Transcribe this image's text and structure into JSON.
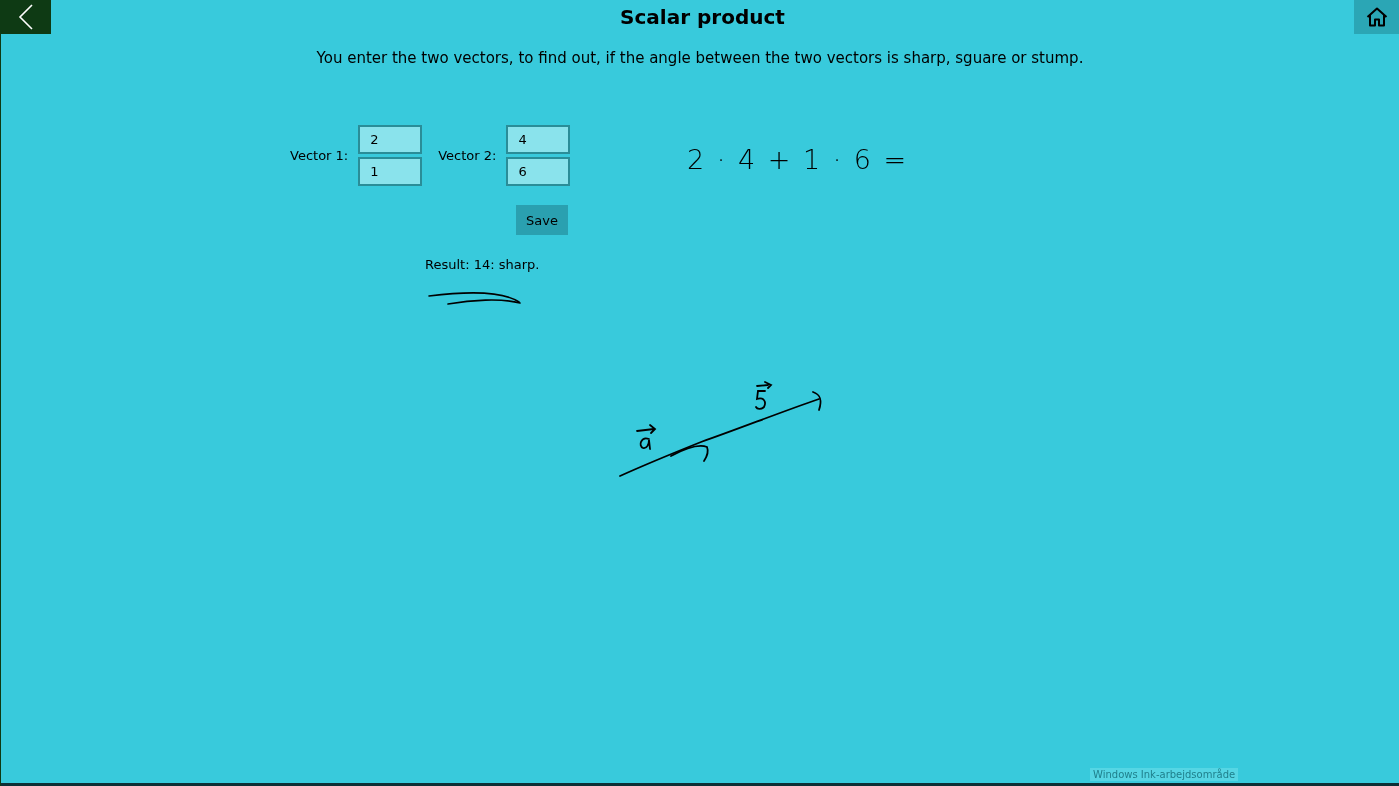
{
  "header": {
    "title": "Scalar product"
  },
  "description": "You enter the two vectors, to find out, if the angle between the two vectors is sharp, sguare or stump.",
  "vectors": [
    {
      "label": "Vector 1:",
      "values": [
        "2",
        "1"
      ]
    },
    {
      "label": "Vector 2:",
      "values": [
        "4",
        "6"
      ]
    }
  ],
  "save_button": "Save",
  "result": "Result: 14: sharp.",
  "ink": {
    "formula": "2 · 4 + 1 · 6 ="
  },
  "ink_workspace_label": "Windows Ink-arbejdsområde"
}
